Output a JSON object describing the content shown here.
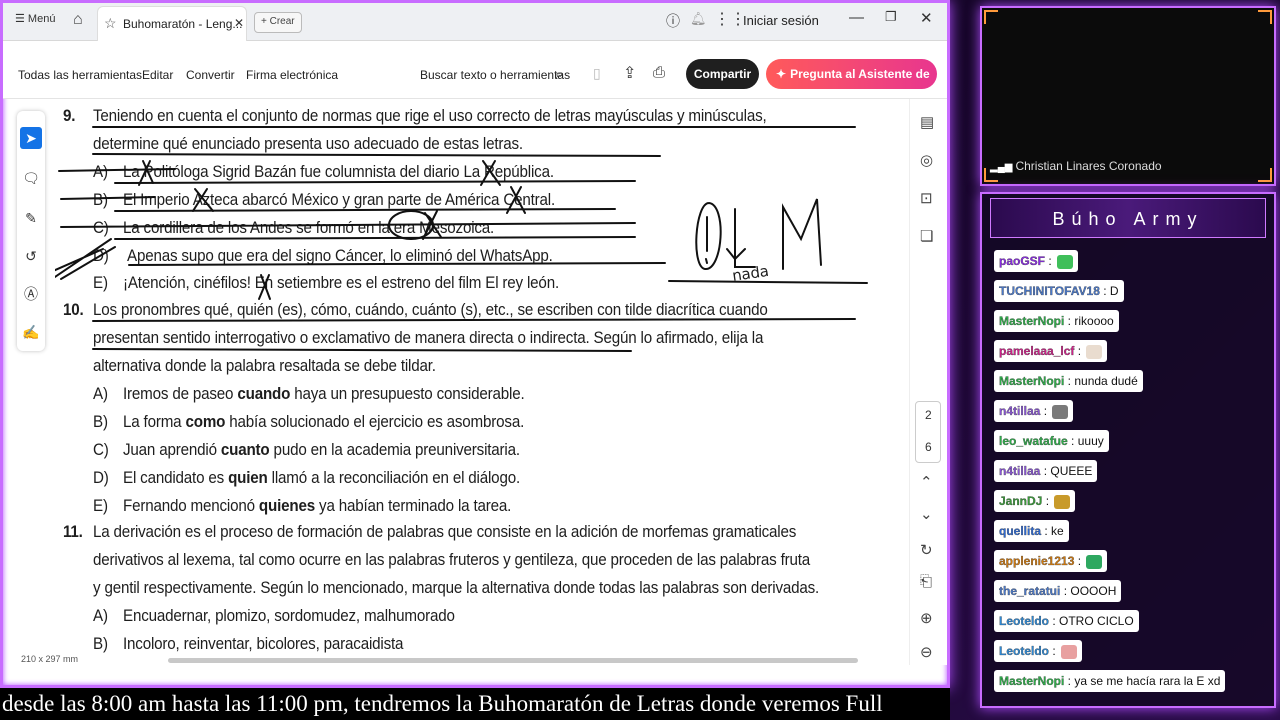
{
  "browser": {
    "menu_label": "☰ Menú",
    "tab_title": "Buhomaratón - Leng...",
    "create_label": "+ Crear",
    "signin_label": "Iniciar sesión"
  },
  "toolbar": {
    "all_tools": "Todas las herramientas",
    "edit": "Editar",
    "convert": "Convertir",
    "esign": "Firma electrónica",
    "search_placeholder": "Buscar texto o herramientas",
    "share": "Compartir",
    "ai_assistant": "Pregunta al Asistente de IA"
  },
  "document": {
    "q9": {
      "num": "9.",
      "line1": "Teniendo en cuenta el conjunto de normas que rige el uso correcto de letras mayúsculas y minúsculas,",
      "line2": "determine qué enunciado presenta uso adecuado de estas letras.",
      "options": [
        {
          "letter": "A)",
          "text": "La Politóloga Sigrid Bazán fue columnista del diario La República."
        },
        {
          "letter": "B)",
          "text": "El Imperio Azteca abarcó México y gran parte de América Central."
        },
        {
          "letter": "C)",
          "text": "La cordillera de los Andes se formó en la era Mesozoica."
        },
        {
          "letter": "D)",
          "text": "Apenas supo que era del signo Cáncer, lo eliminó del WhatsApp."
        },
        {
          "letter": "E)",
          "text": "¡Atención, cinéfilos! En setiembre es el estreno del film El rey león."
        }
      ]
    },
    "q10": {
      "num": "10.",
      "line1": "Los pronombres qué, quién (es), cómo, cuándo, cuánto (s), etc., se escriben con tilde diacrítica cuando",
      "line2": "presentan sentido interrogativo o exclamativo de manera directa o indirecta. Según lo afirmado, elija la",
      "line3": "alternativa donde la palabra resaltada se debe tildar.",
      "options": [
        {
          "letter": "A)",
          "pre": "Iremos de paseo ",
          "kw": "cuando",
          "post": " haya un presupuesto considerable."
        },
        {
          "letter": "B)",
          "pre": "La forma ",
          "kw": "como",
          "post": " había solucionado el ejercicio es asombrosa."
        },
        {
          "letter": "C)",
          "pre": "Juan aprendió ",
          "kw": "cuanto",
          "post": " pudo en la academia preuniversitaria."
        },
        {
          "letter": "D)",
          "pre": "El candidato es ",
          "kw": "quien",
          "post": " llamó a la reconciliación en el diálogo."
        },
        {
          "letter": "E)",
          "pre": "Fernando mencionó ",
          "kw": "quienes",
          "post": " ya habían terminado la tarea."
        }
      ]
    },
    "q11": {
      "num": "11.",
      "line1": "La derivación es el proceso de formación de palabras que consiste en la adición de morfemas gramaticales",
      "line2": "derivativos al lexema, tal como ocurre en las palabras fruteros y gentileza, que proceden de las palabras fruta",
      "line3": "y gentil respectivamente. Según lo mencionado, marque la alternativa donde todas las palabras son derivadas.",
      "options": [
        {
          "letter": "A)",
          "text": "Encuadernar, plomizo, sordomudez, malhumorado"
        },
        {
          "letter": "B)",
          "text": "Incoloro, reinventar, bicolores, paracaidista"
        }
      ]
    },
    "handwriting": "nada",
    "page_size": "210 x 297 mm",
    "page_current": "2",
    "page_total": "6"
  },
  "ticker": "desde las 8:00 am hasta las 11:00 pm, tendremos la Buhomaratón de Letras donde veremos Full",
  "webcam": {
    "name": "Christian Linares Coronado"
  },
  "chat": {
    "title": "Búho Army",
    "messages": [
      {
        "user": "paoGSF",
        "color": "#8a2be2",
        "text": "",
        "emote": "#3fbf5a"
      },
      {
        "user": "TUCHINITOFAV18",
        "color": "#4a78c8",
        "text": "D",
        "emote": ""
      },
      {
        "user": "MasterNopi",
        "color": "#2eae4a",
        "text": "rikoooo",
        "emote": ""
      },
      {
        "user": "pamelaaa_lcf",
        "color": "#d0208a",
        "text": "",
        "emote": "#e9dccf"
      },
      {
        "user": "MasterNopi",
        "color": "#2eae4a",
        "text": "nunda dudé",
        "emote": ""
      },
      {
        "user": "n4tillaa",
        "color": "#8a55d6",
        "text": "",
        "emote": "#7a7a7a"
      },
      {
        "user": "leo_watafue",
        "color": "#2eae4a",
        "text": "uuuy",
        "emote": ""
      },
      {
        "user": "n4tillaa",
        "color": "#8a55d6",
        "text": "QUEEE",
        "emote": ""
      },
      {
        "user": "JannDJ",
        "color": "#3a9a3a",
        "text": "",
        "emote": "#c89a2a"
      },
      {
        "user": "quellita",
        "color": "#2e6bd6",
        "text": "ke",
        "emote": ""
      },
      {
        "user": "applenie1213",
        "color": "#d07a10",
        "text": "",
        "emote": "#2ea860"
      },
      {
        "user": "the_ratatui",
        "color": "#4a78c8",
        "text": "OOOOH",
        "emote": ""
      },
      {
        "user": "Leoteldo",
        "color": "#2e8ad6",
        "text": "OTRO CICLO",
        "emote": ""
      },
      {
        "user": "Leoteldo",
        "color": "#2e8ad6",
        "text": "",
        "emote": "#e8a0a0"
      },
      {
        "user": "MasterNopi",
        "color": "#2eae4a",
        "text": "ya se me hacía rara la E xd",
        "emote": ""
      }
    ]
  }
}
